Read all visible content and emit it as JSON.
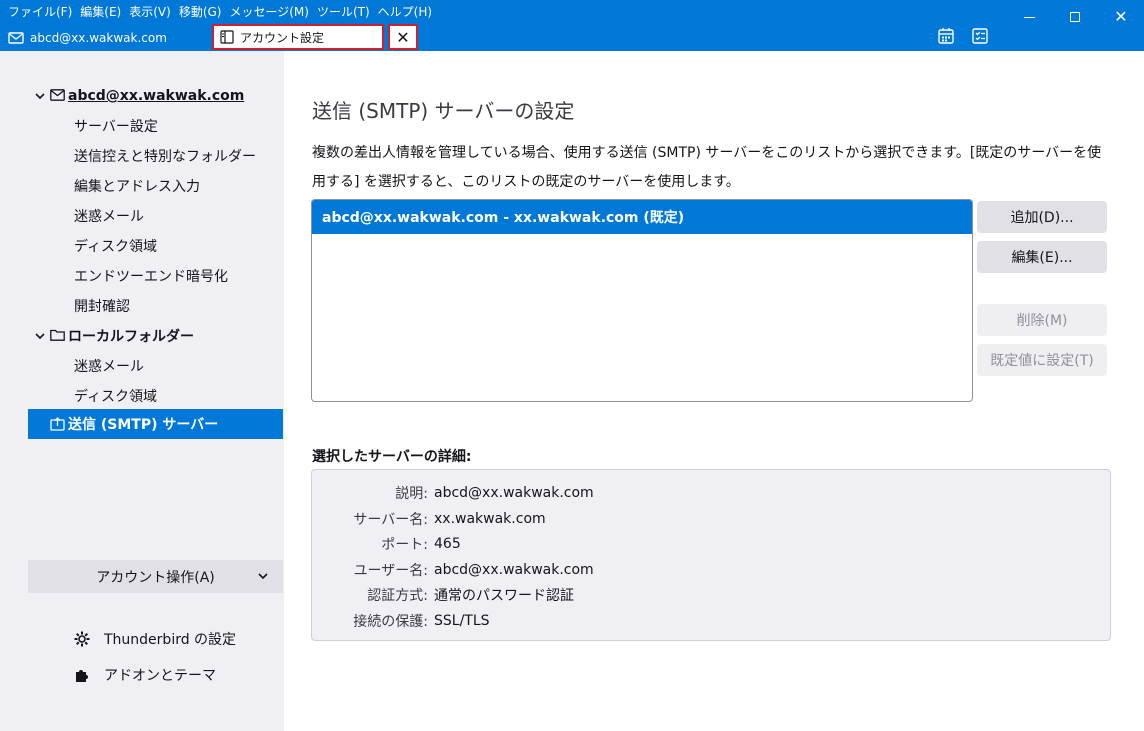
{
  "menubar": {
    "items": [
      "ファイル(F)",
      "編集(E)",
      "表示(V)",
      "移動(G)",
      "メッセージ(M)",
      "ツール(T)",
      "ヘルプ(H)"
    ]
  },
  "tabs": {
    "mail_tab_label": "abcd@xx.wakwak.com",
    "settings_tab_label": "アカウント設定",
    "close_label": "✕"
  },
  "sidebar": {
    "account_name": "abcd@xx.wakwak.com",
    "account_children": [
      "サーバー設定",
      "送信控えと特別なフォルダー",
      "編集とアドレス入力",
      "迷惑メール",
      "ディスク領域",
      "エンドツーエンド暗号化",
      "開封確認"
    ],
    "local_folders_name": "ローカルフォルダー",
    "local_children": [
      "迷惑メール",
      "ディスク領域"
    ],
    "smtp_label": "送信 (SMTP) サーバー",
    "account_actions_label": "アカウント操作(A)",
    "thunderbird_settings_label": "Thunderbird の設定",
    "addons_label": "アドオンとテーマ"
  },
  "main": {
    "title": "送信 (SMTP) サーバーの設定",
    "description": "複数の差出人情報を管理している場合、使用する送信 (SMTP) サーバーをこのリストから選択できます。[既定のサーバーを使用する] を選択すると、このリストの既定のサーバーを使用します。",
    "servers": [
      "abcd@xx.wakwak.com - xx.wakwak.com (既定)"
    ],
    "buttons": {
      "add": "追加(D)...",
      "edit": "編集(E)...",
      "delete": "削除(M)",
      "set_default": "既定値に設定(T)"
    },
    "details_heading": "選択したサーバーの詳細:",
    "details": [
      {
        "label": "説明:",
        "value": "abcd@xx.wakwak.com"
      },
      {
        "label": "サーバー名:",
        "value": "xx.wakwak.com"
      },
      {
        "label": "ポート:",
        "value": "465"
      },
      {
        "label": "ユーザー名:",
        "value": "abcd@xx.wakwak.com"
      },
      {
        "label": "認証方式:",
        "value": "通常のパスワード認証"
      },
      {
        "label": "接続の保護:",
        "value": "SSL/TLS"
      }
    ]
  },
  "colors": {
    "accent": "#0078d7",
    "highlight_border": "#d21f2c",
    "sidebar_bg": "#f0f0f4"
  }
}
